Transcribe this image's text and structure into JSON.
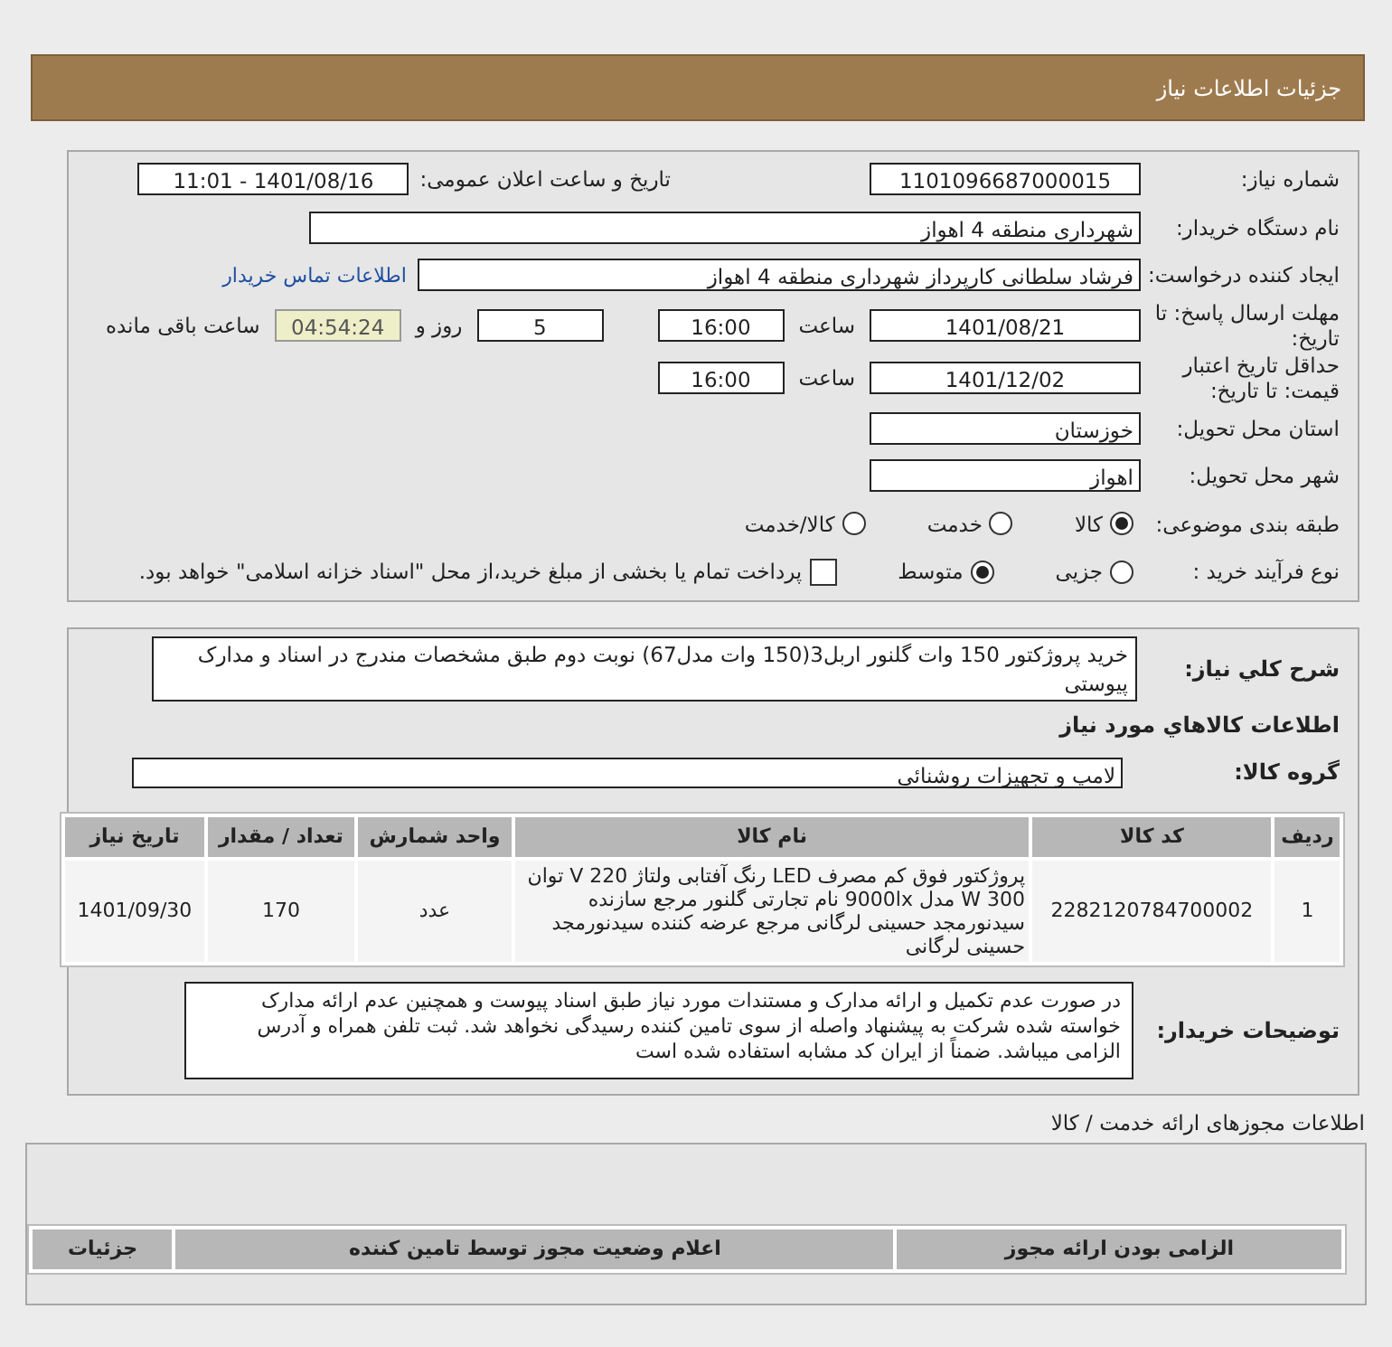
{
  "header": {
    "title": "جزئیات اطلاعات نیاز"
  },
  "need_number": {
    "label": "شماره نیاز:",
    "value": "1101096687000015"
  },
  "announce": {
    "label": "تاریخ و ساعت اعلان عمومی:",
    "value": "1401/08/16 - 11:01"
  },
  "buyer": {
    "label": "نام دستگاه خریدار:",
    "value": "شهرداری منطقه 4 اهواز"
  },
  "creator": {
    "label": "ایجاد کننده درخواست:",
    "value": "فرشاد سلطانی کارپرداز شهرداری منطقه 4 اهواز",
    "link": "اطلاعات تماس خریدار"
  },
  "deadline": {
    "label": "مهلت ارسال پاسخ: تا تاریخ:",
    "date": "1401/08/21",
    "time_label": "ساعت",
    "time": "16:00",
    "days": "5",
    "days_label": "روز و",
    "remaining": "04:54:24",
    "remaining_label": "ساعت باقی مانده"
  },
  "validity": {
    "label": "حداقل تاریخ اعتبار قیمت: تا تاریخ:",
    "date": "1401/12/02",
    "time_label": "ساعت",
    "time": "16:00"
  },
  "province": {
    "label": "استان محل تحویل:",
    "value": "خوزستان"
  },
  "city": {
    "label": "شهر محل تحویل:",
    "value": "اهواز"
  },
  "category": {
    "label": "طبقه بندی موضوعی:",
    "options": [
      {
        "label": "کالا",
        "selected": true
      },
      {
        "label": "خدمت",
        "selected": false
      },
      {
        "label": "کالا/خدمت",
        "selected": false
      }
    ]
  },
  "process": {
    "label": "نوع فرآیند خرید :",
    "options": [
      {
        "label": "جزیی",
        "selected": false
      },
      {
        "label": "متوسط",
        "selected": true
      }
    ],
    "payment": {
      "label": "پرداخت تمام یا بخشی از مبلغ خرید،از محل \"اسناد خزانه اسلامی\" خواهد بود.",
      "checked": false
    }
  },
  "description": {
    "label": "شرح کلي نياز:",
    "value": "خرید پروژکتور 150 وات گلنور اربل3(150 وات مدل67) نوبت دوم طبق مشخصات مندرج در اسناد و مدارک پیوستی"
  },
  "goods_heading": "اطلاعات کالاهاي مورد نياز",
  "goods_group": {
    "label": "گروه کالا:",
    "value": "لامپ و تجهیزات روشنائی"
  },
  "items_table": {
    "columns": [
      "ردیف",
      "کد کالا",
      "نام کالا",
      "واحد شمارش",
      "تعداد / مقدار",
      "تاریخ نیاز"
    ],
    "rows": [
      [
        "1",
        "2282120784700002",
        "پروژکتور فوق کم مصرف LED رنگ آفتابی ولتاژ 220 V توان 300 W مدل 9000lx نام تجارتی گلنور مرجع سازنده سیدنورمجد حسینی لرگانی مرجع عرضه کننده سیدنورمجد حسینی لرگانی",
        "عدد",
        "170",
        "1401/09/30"
      ]
    ]
  },
  "buyer_notes": {
    "label": "توضیحات خریدار:",
    "value": "در صورت عدم تکمیل و ارائه مدارک و مستندات مورد نیاز طبق اسناد  پیوست  و  همچنین  عدم  ارائه مدارک  خواسته شده شرکت به پیشنهاد واصله از سوی تامین کننده رسیدگی نخواهد شد. ثبت تلفن همراه و آدرس الزامی میباشد. ضمناً  از ایران کد مشابه استفاده شده است"
  },
  "permits_heading": "اطلاعات مجوزهای ارائه خدمت / کالا",
  "permits_table": {
    "columns": [
      "الزامی بودن ارائه مجوز",
      "اعلام وضعیت مجوز توسط تامین کننده",
      "جزئیات"
    ]
  }
}
